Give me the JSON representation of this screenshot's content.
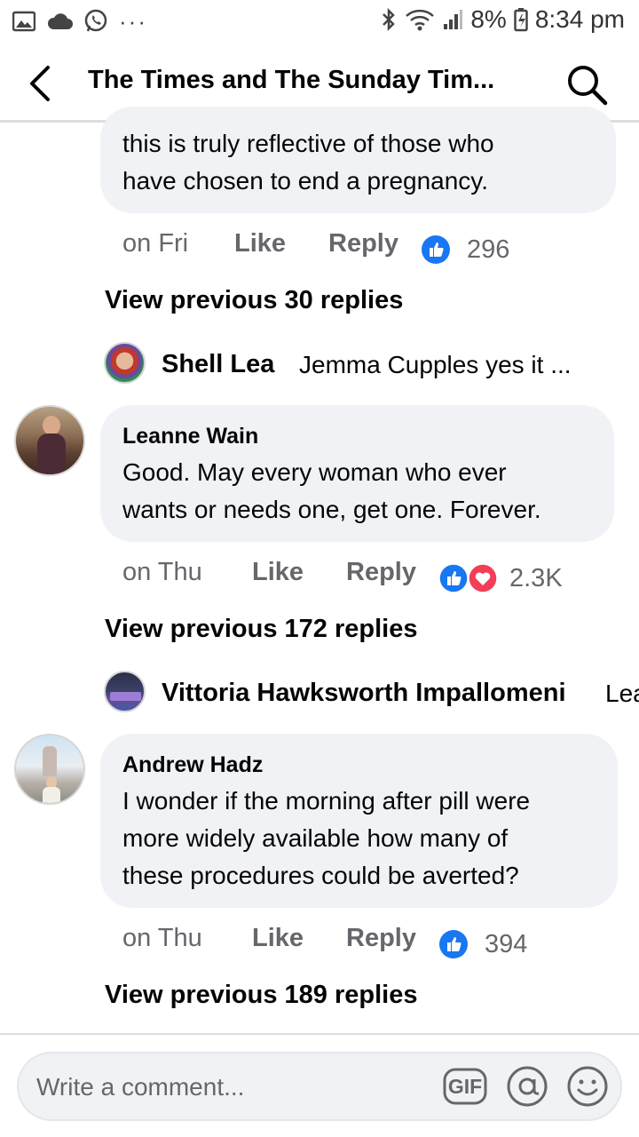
{
  "status_bar": {
    "battery": "8%",
    "time": "8:34 pm",
    "more": "···"
  },
  "header": {
    "title": "The Times and The Sunday Tim..."
  },
  "comments": [
    {
      "text_lines": [
        "this is truly reflective of those who",
        "have chosen to end a pregnancy."
      ],
      "time": "on Fri",
      "like_label": "Like",
      "reply_label": "Reply",
      "reactions": [
        "like-icon"
      ],
      "reaction_count": "296",
      "view_previous": "View previous 30 replies",
      "reply_preview": {
        "name": "Shell Lea",
        "text": "Jemma Cupples yes it ..."
      }
    },
    {
      "author": "Leanne Wain",
      "text_lines": [
        "Good. May every woman who ever",
        "wants or needs one, get one. Forever."
      ],
      "time": "on Thu",
      "like_label": "Like",
      "reply_label": "Reply",
      "reactions": [
        "like-icon",
        "love-icon"
      ],
      "reaction_count": "2.3K",
      "view_previous": "View previous 172 replies",
      "reply_preview": {
        "name": "Vittoria Hawksworth Impallomeni",
        "text": "Lea"
      }
    },
    {
      "author": "Andrew Hadz",
      "text_lines": [
        "I wonder if the morning after pill were",
        "more widely available how many of",
        "these procedures could be averted?"
      ],
      "time": "on Thu",
      "like_label": "Like",
      "reply_label": "Reply",
      "reactions": [
        "like-icon"
      ],
      "reaction_count": "394",
      "view_previous": "View previous 189 replies"
    }
  ],
  "composer": {
    "placeholder": "Write a comment...",
    "gif_label": "GIF"
  },
  "colors": {
    "bubble": "#f0f2f5",
    "like_blue": "#1877f2",
    "love_red": "#f33e58",
    "secondary_text": "#65676b"
  }
}
